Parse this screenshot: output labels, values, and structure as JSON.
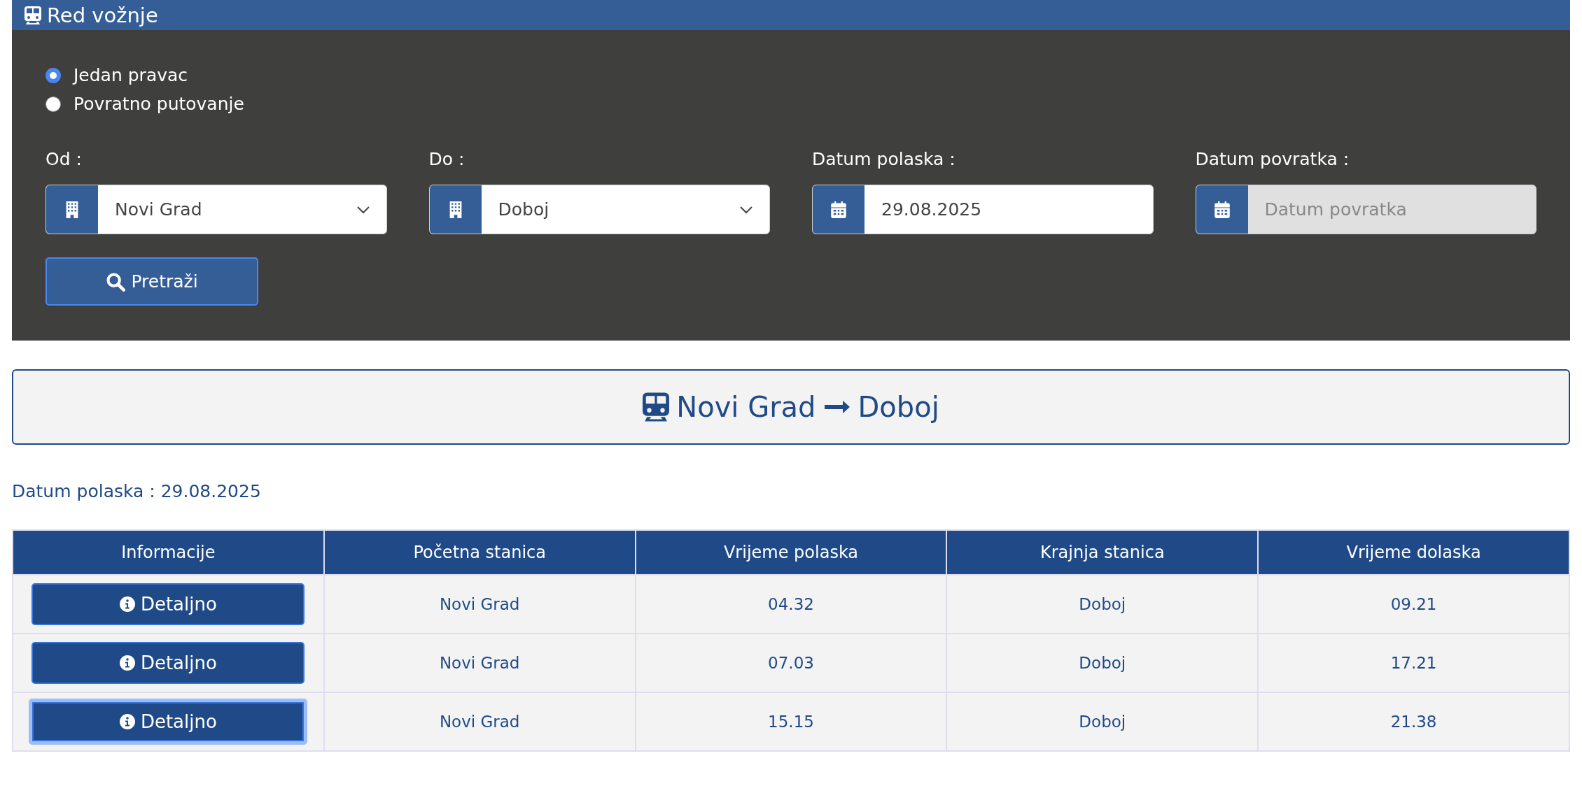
{
  "header": {
    "title": "Red vožnje"
  },
  "trip_type": [
    {
      "label": "Jedan pravac",
      "selected": true
    },
    {
      "label": "Povratno putovanje",
      "selected": false
    }
  ],
  "fields": [
    {
      "kind": "select",
      "label": "Od :",
      "value": "Novi Grad",
      "disabled": false
    },
    {
      "kind": "select",
      "label": "Do :",
      "value": "Doboj",
      "disabled": false
    },
    {
      "kind": "date",
      "label": "Datum polaska :",
      "value": "29.08.2025",
      "disabled": false
    },
    {
      "kind": "date",
      "label": "Datum povratka :",
      "placeholder": "Datum povratka",
      "disabled": true
    }
  ],
  "search_button": "Pretraži",
  "route": {
    "from": "Novi Grad",
    "to": "Doboj"
  },
  "date_line": "Datum polaska : 29.08.2025",
  "table": {
    "columns": [
      "Informacije",
      "Početna stanica",
      "Vrijeme polaska",
      "Krajnja stanica",
      "Vrijeme dolaska"
    ],
    "rows": [
      {
        "focused": false,
        "cells": [
          "Detaljno",
          "Novi Grad",
          "04.32",
          "Doboj",
          "09.21"
        ]
      },
      {
        "focused": false,
        "cells": [
          "Detaljno",
          "Novi Grad",
          "07.03",
          "Doboj",
          "17.21"
        ]
      },
      {
        "focused": true,
        "cells": [
          "Detaljno",
          "Novi Grad",
          "15.15",
          "Doboj",
          "21.38"
        ]
      }
    ]
  }
}
